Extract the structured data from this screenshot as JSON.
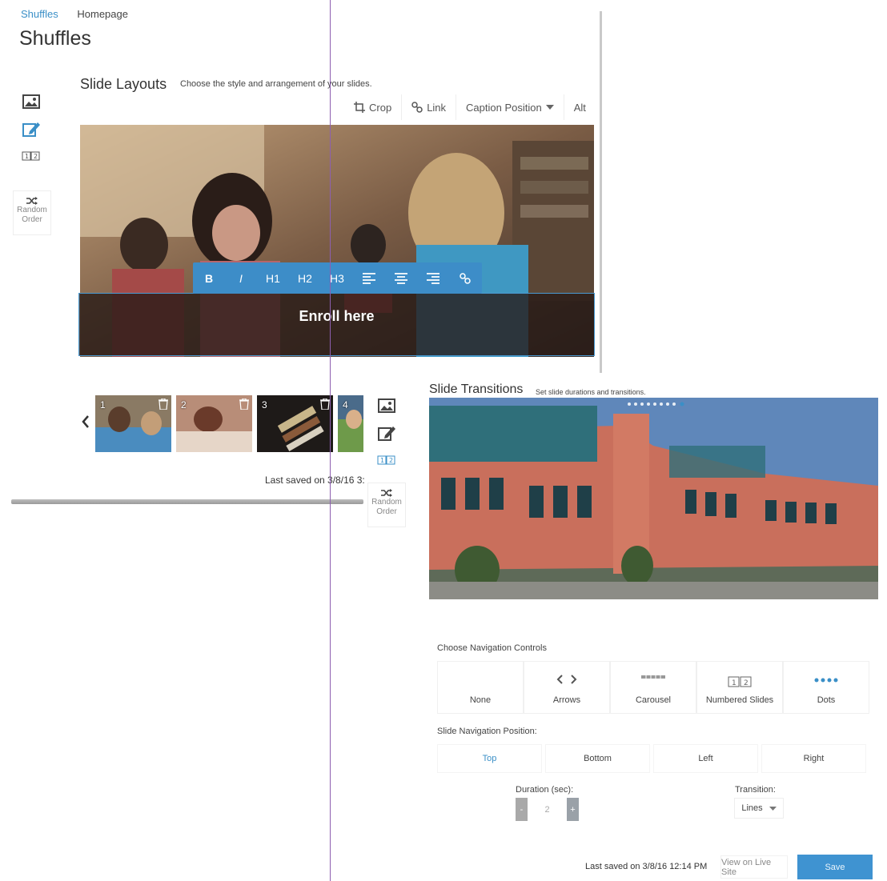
{
  "breadcrumb": {
    "parent": "Shuffles",
    "current": "Homepage"
  },
  "page": {
    "title": "Shuffles"
  },
  "slide_layouts": {
    "title": "Slide Layouts",
    "subtitle": "Choose the style and arrangement of your slides.",
    "image_toolbar": {
      "crop": "Crop",
      "link": "Link",
      "caption_position": "Caption Position",
      "alt": "Alt"
    },
    "format_toolbar": [
      "B",
      "I",
      "H1",
      "H2",
      "H3"
    ],
    "caption": "Enroll here",
    "thumbnails": [
      "1",
      "2",
      "3",
      "4"
    ],
    "last_saved": "Last saved on 3/8/16 3:"
  },
  "toolstrip": {
    "random_order_line1": "Random",
    "random_order_line2": "Order"
  },
  "slide_transitions": {
    "title": "Slide Transitions",
    "subtitle": "Set slide durations and transitions.",
    "nav_controls_label": "Choose Navigation Controls",
    "nav_controls": [
      "None",
      "Arrows",
      "Carousel",
      "Numbered Slides",
      "Dots"
    ],
    "nav_position_label": "Slide Navigation Position:",
    "nav_positions": [
      "Top",
      "Bottom",
      "Left",
      "Right"
    ],
    "nav_position_selected": "Top",
    "duration_label": "Duration (sec):",
    "duration_value": "2",
    "duration_minus": "-",
    "duration_plus": "+",
    "transition_label": "Transition:",
    "transition_value": "Lines",
    "last_saved": "Last saved on 3/8/16 12:14 PM",
    "view_live": "View on Live Site",
    "save": "Save"
  },
  "colors": {
    "accent": "#3f93d1",
    "guide": "#8d5fb0",
    "format_toolbar": "#3d8dc8"
  }
}
